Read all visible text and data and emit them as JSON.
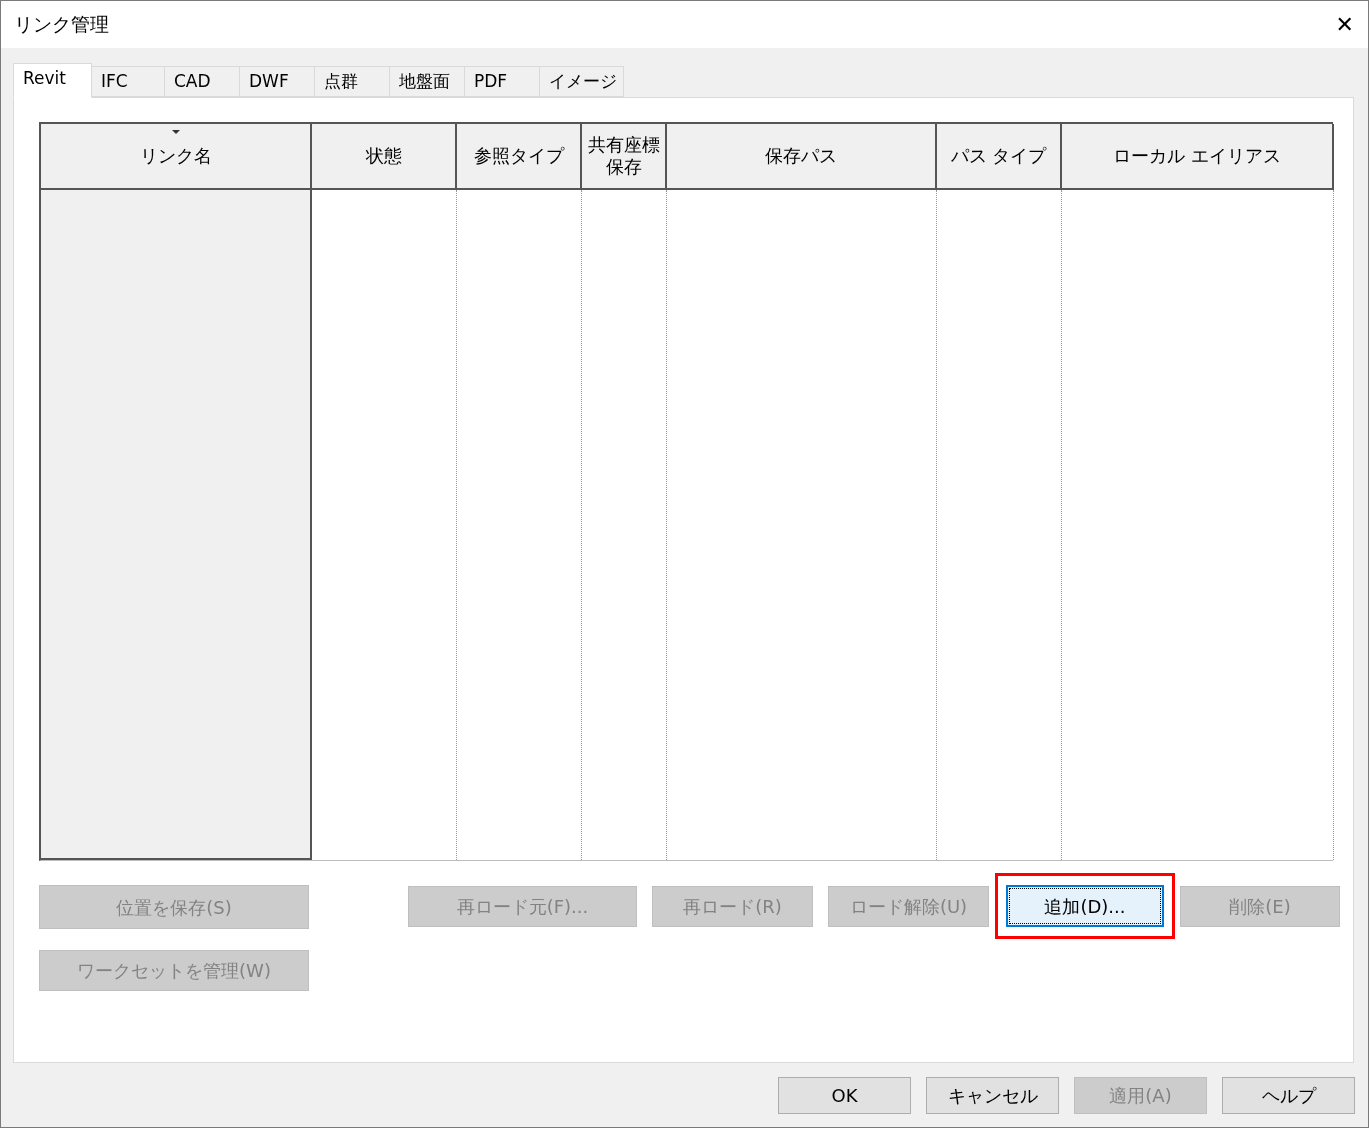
{
  "window": {
    "title": "リンク管理",
    "close": "✕"
  },
  "tabs": [
    {
      "label": "Revit",
      "selected": true
    },
    {
      "label": "IFC",
      "selected": false
    },
    {
      "label": "CAD",
      "selected": false
    },
    {
      "label": "DWF",
      "selected": false
    },
    {
      "label": "点群",
      "selected": false
    },
    {
      "label": "地盤面",
      "selected": false
    },
    {
      "label": "PDF",
      "selected": false
    },
    {
      "label": "イメージ",
      "selected": false
    }
  ],
  "table": {
    "columns": [
      {
        "label": "リンク名",
        "sorted": true
      },
      {
        "label": "状態",
        "sorted": false
      },
      {
        "label": "参照タイプ",
        "sorted": false
      },
      {
        "label": "共有座標保存",
        "sorted": false
      },
      {
        "label": "保存パス",
        "sorted": false
      },
      {
        "label": "パス タイプ",
        "sorted": false
      },
      {
        "label": "ローカル エイリアス",
        "sorted": false
      }
    ]
  },
  "side_buttons": [
    {
      "label": "位置を保存(S)",
      "disabled": true
    },
    {
      "label": "ワークセットを管理(W)",
      "disabled": true
    }
  ],
  "link_buttons": [
    {
      "label": "再ロード元(F)...",
      "disabled": true,
      "highlighted": false
    },
    {
      "label": "再ロード(R)",
      "disabled": true,
      "highlighted": false
    },
    {
      "label": "ロード解除(U)",
      "disabled": true,
      "highlighted": false
    },
    {
      "label": "追加(D)...",
      "disabled": false,
      "highlighted": true
    },
    {
      "label": "削除(E)",
      "disabled": true,
      "highlighted": false
    }
  ],
  "dialog_buttons": [
    {
      "label": "OK",
      "disabled": false
    },
    {
      "label": "キャンセル",
      "disabled": false
    },
    {
      "label": "適用(A)",
      "disabled": true
    },
    {
      "label": "ヘルプ",
      "disabled": false
    }
  ]
}
